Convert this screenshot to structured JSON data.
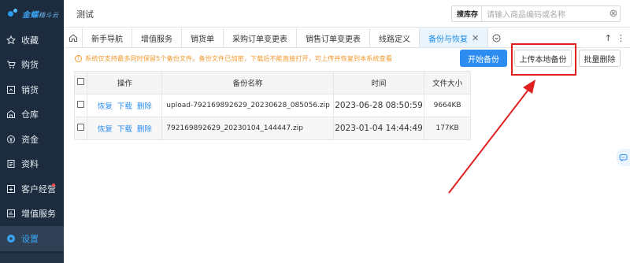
{
  "brand": {
    "name": "金蝶",
    "sub": "精斗云"
  },
  "sidebar": {
    "items": [
      {
        "label": "收藏",
        "icon": "star-icon"
      },
      {
        "label": "购货",
        "icon": "cart-icon"
      },
      {
        "label": "销货",
        "icon": "sales-icon"
      },
      {
        "label": "仓库",
        "icon": "warehouse-icon"
      },
      {
        "label": "资金",
        "icon": "money-icon"
      },
      {
        "label": "资料",
        "icon": "document-icon"
      },
      {
        "label": "客户经营",
        "icon": "customer-icon",
        "badge": true
      },
      {
        "label": "增值服务",
        "icon": "service-icon"
      },
      {
        "label": "设置",
        "icon": "settings-icon",
        "active": true
      }
    ]
  },
  "header": {
    "title": "测试",
    "search": {
      "scope": "搜库存",
      "placeholder": "请输入商品编码或名称"
    }
  },
  "tabs": {
    "items": [
      "新手导航",
      "增值服务",
      "销货单",
      "采购订单变更表",
      "销售订单变更表",
      "线路定义",
      "备份与恢复"
    ],
    "active": "备份与恢复"
  },
  "notice": "系统仅支持最多同时保留5个备份文件。备份文件已加密，下载后不能直接打开，可上传并恢复到本系统查看",
  "toolbar": {
    "start_backup": "开始备份",
    "upload_local": "上传本地备份",
    "batch_delete": "批量删除"
  },
  "table": {
    "headers": {
      "ops": "操作",
      "name": "备份名称",
      "time": "时间",
      "size": "文件大小"
    },
    "op_labels": {
      "restore": "恢复",
      "download": "下载",
      "delete": "删除"
    },
    "rows": [
      {
        "name": "upload-792169892629_20230628_085056.zip",
        "time": "2023-06-28 08:50:59",
        "size": "9664KB"
      },
      {
        "name": "792169892629_20230104_144447.zip",
        "time": "2023-01-04 14:44:49",
        "size": "177KB"
      }
    ]
  },
  "colors": {
    "sidebar": "#1c2b3d",
    "accent": "#2d8cf0",
    "warning": "#f29a2e",
    "annotation": "#e02020"
  }
}
